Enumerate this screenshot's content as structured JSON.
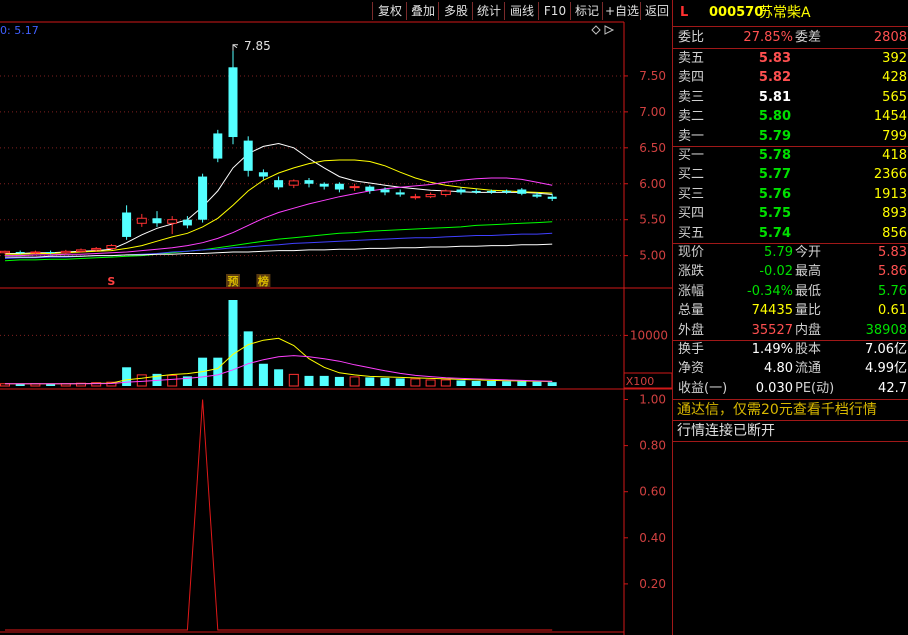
{
  "toolbar": {
    "buttons": [
      "复权",
      "叠加",
      "多股",
      "统计",
      "画线",
      "F10",
      "标记",
      "+自选",
      "返回"
    ]
  },
  "main_chart": {
    "ma_legend": "0: 5.17",
    "peak_label": "7.85",
    "y_ticks": [
      "7.50",
      "7.00",
      "6.50",
      "6.00",
      "5.50",
      "5.00"
    ],
    "markers": [
      "S",
      "预",
      "榜"
    ],
    "colors": {
      "up": "#ff3232",
      "down": "#54ffff",
      "ma5": "#ffffff",
      "ma10": "#ffff00",
      "ma20": "#ff40ff",
      "ma30": "#00ff00",
      "ma60": "#4040ff",
      "ma120": "#ffffff"
    }
  },
  "volume_chart": {
    "y_tick": "10000",
    "scale_label": "X100"
  },
  "indicator_chart": {
    "y_ticks": [
      "1.00",
      "0.80",
      "0.60",
      "0.40",
      "0.20"
    ]
  },
  "quote": {
    "indicator": "L",
    "code": "000570",
    "name": "苏常柴A",
    "weibi_label": "委比",
    "weibi": "27.85%",
    "weicha_label": "委差",
    "weicha": "2808",
    "asks": [
      {
        "label": "卖五",
        "price": "5.83",
        "vol": "392"
      },
      {
        "label": "卖四",
        "price": "5.82",
        "vol": "428"
      },
      {
        "label": "卖三",
        "price": "5.81",
        "vol": "565"
      },
      {
        "label": "卖二",
        "price": "5.80",
        "vol": "1454"
      },
      {
        "label": "卖一",
        "price": "5.79",
        "vol": "799"
      }
    ],
    "bids": [
      {
        "label": "买一",
        "price": "5.78",
        "vol": "418"
      },
      {
        "label": "买二",
        "price": "5.77",
        "vol": "2366"
      },
      {
        "label": "买三",
        "price": "5.76",
        "vol": "1913"
      },
      {
        "label": "买四",
        "price": "5.75",
        "vol": "893"
      },
      {
        "label": "买五",
        "price": "5.74",
        "vol": "856"
      }
    ],
    "stats": [
      {
        "l1": "现价",
        "v1": "5.79",
        "l2": "今开",
        "v2": "5.83"
      },
      {
        "l1": "涨跌",
        "v1": "-0.02",
        "l2": "最高",
        "v2": "5.86"
      },
      {
        "l1": "涨幅",
        "v1": "-0.34%",
        "l2": "最低",
        "v2": "5.76"
      },
      {
        "l1": "总量",
        "v1": "74435",
        "l2": "量比",
        "v2": "0.61"
      },
      {
        "l1": "外盘",
        "v1": "35527",
        "l2": "内盘",
        "v2": "38908"
      }
    ],
    "fin": [
      {
        "l1": "换手",
        "v1": "1.49%",
        "l2": "股本",
        "v2": "7.06亿"
      },
      {
        "l1": "净资",
        "v1": "4.80",
        "l2": "流通",
        "v2": "4.99亿"
      },
      {
        "l1": "收益(一)",
        "v1": "0.030",
        "l2": "PE(动)",
        "v2": "42.7"
      }
    ],
    "promo": "通达信，仅需20元查看千档行情",
    "status": "行情连接已断开"
  },
  "chart_data": [
    {
      "type": "candlestick",
      "title": "",
      "ylim": [
        4.8,
        8.0
      ],
      "yticks": [
        5.0,
        5.5,
        6.0,
        6.5,
        7.0,
        7.5
      ],
      "grid": true,
      "candles": [
        [
          5.04,
          5.06,
          5.02,
          5.07
        ],
        [
          5.05,
          5.04,
          5.02,
          5.07
        ],
        [
          5.04,
          5.05,
          5.02,
          5.07
        ],
        [
          5.05,
          5.04,
          5.02,
          5.07
        ],
        [
          5.04,
          5.06,
          5.02,
          5.08
        ],
        [
          5.06,
          5.08,
          5.04,
          5.1
        ],
        [
          5.08,
          5.1,
          5.06,
          5.12
        ],
        [
          5.1,
          5.14,
          5.08,
          5.16
        ],
        [
          5.6,
          5.26,
          5.22,
          5.7
        ],
        [
          5.45,
          5.52,
          5.4,
          5.58
        ],
        [
          5.52,
          5.45,
          5.4,
          5.62
        ],
        [
          5.45,
          5.5,
          5.3,
          5.55
        ],
        [
          5.5,
          5.42,
          5.38,
          5.55
        ],
        [
          6.1,
          5.5,
          5.46,
          6.14
        ],
        [
          6.7,
          6.35,
          6.3,
          6.75
        ],
        [
          7.62,
          6.65,
          6.55,
          7.85
        ],
        [
          6.6,
          6.18,
          6.1,
          6.66
        ],
        [
          6.16,
          6.1,
          6.06,
          6.2
        ],
        [
          6.05,
          5.95,
          5.92,
          6.1
        ],
        [
          5.98,
          6.04,
          5.94,
          6.06
        ],
        [
          6.05,
          6.0,
          5.95,
          6.08
        ],
        [
          6.0,
          5.96,
          5.92,
          6.02
        ],
        [
          6.0,
          5.92,
          5.88,
          6.02
        ],
        [
          5.95,
          5.96,
          5.9,
          6.0
        ],
        [
          5.96,
          5.9,
          5.86,
          5.98
        ],
        [
          5.92,
          5.88,
          5.84,
          5.95
        ],
        [
          5.88,
          5.85,
          5.82,
          5.92
        ],
        [
          5.82,
          5.82,
          5.78,
          5.86
        ],
        [
          5.82,
          5.85,
          5.8,
          5.88
        ],
        [
          5.85,
          5.9,
          5.82,
          5.92
        ],
        [
          5.92,
          5.88,
          5.85,
          5.95
        ],
        [
          5.9,
          5.88,
          5.86,
          5.93
        ],
        [
          5.9,
          5.88,
          5.86,
          5.92
        ],
        [
          5.9,
          5.88,
          5.86,
          5.92
        ],
        [
          5.92,
          5.86,
          5.84,
          5.94
        ],
        [
          5.85,
          5.82,
          5.8,
          5.88
        ],
        [
          5.82,
          5.79,
          5.76,
          5.86
        ]
      ],
      "ma_series": [
        {
          "values": [
            5.03,
            5.03,
            5.04,
            5.04,
            5.05,
            5.06,
            5.07,
            5.09,
            5.18,
            5.29,
            5.38,
            5.44,
            5.5,
            5.68,
            5.9,
            6.22,
            6.42,
            6.52,
            6.56,
            6.5,
            6.35,
            6.22,
            6.1,
            6.04,
            6.01,
            5.98,
            5.95,
            5.93,
            5.91,
            5.9,
            5.89,
            5.88,
            5.88,
            5.88,
            5.88,
            5.87,
            5.85
          ]
        },
        {
          "values": [
            5.02,
            5.02,
            5.03,
            5.03,
            5.04,
            5.05,
            5.06,
            5.07,
            5.1,
            5.14,
            5.2,
            5.26,
            5.31,
            5.4,
            5.52,
            5.7,
            5.9,
            6.05,
            6.15,
            6.22,
            6.28,
            6.32,
            6.33,
            6.33,
            6.31,
            6.25,
            6.16,
            6.08,
            6.02,
            5.98,
            5.95,
            5.93,
            5.91,
            5.9,
            5.89,
            5.88,
            5.87
          ]
        },
        {
          "values": [
            5.0,
            5.0,
            5.01,
            5.01,
            5.02,
            5.02,
            5.03,
            5.04,
            5.05,
            5.07,
            5.09,
            5.11,
            5.14,
            5.18,
            5.24,
            5.32,
            5.42,
            5.52,
            5.6,
            5.66,
            5.72,
            5.77,
            5.82,
            5.86,
            5.9,
            5.93,
            5.95,
            5.97,
            5.99,
            6.02,
            6.05,
            6.07,
            6.08,
            6.08,
            6.06,
            6.02,
            5.98
          ]
        },
        {
          "values": [
            4.93,
            4.94,
            4.94,
            4.95,
            4.95,
            4.96,
            4.97,
            4.98,
            4.99,
            5.0,
            5.02,
            5.04,
            5.06,
            5.08,
            5.11,
            5.14,
            5.17,
            5.2,
            5.23,
            5.25,
            5.27,
            5.29,
            5.31,
            5.32,
            5.34,
            5.35,
            5.36,
            5.37,
            5.38,
            5.39,
            5.4,
            5.42,
            5.43,
            5.44,
            5.45,
            5.46,
            5.47
          ]
        },
        {
          "values": [
            4.96,
            4.97,
            4.97,
            4.98,
            4.98,
            4.99,
            5.0,
            5.0,
            5.01,
            5.02,
            5.03,
            5.05,
            5.06,
            5.08,
            5.09,
            5.11,
            5.12,
            5.14,
            5.15,
            5.17,
            5.18,
            5.19,
            5.2,
            5.21,
            5.22,
            5.23,
            5.24,
            5.25,
            5.25,
            5.26,
            5.27,
            5.28,
            5.28,
            5.29,
            5.3,
            5.3,
            5.31
          ]
        },
        {
          "values": [
            4.98,
            4.98,
            4.98,
            4.99,
            4.99,
            4.99,
            5.0,
            5.0,
            5.01,
            5.01,
            5.02,
            5.02,
            5.03,
            5.03,
            5.04,
            5.05,
            5.05,
            5.06,
            5.07,
            5.07,
            5.08,
            5.08,
            5.09,
            5.09,
            5.1,
            5.1,
            5.11,
            5.11,
            5.12,
            5.12,
            5.13,
            5.13,
            5.14,
            5.14,
            5.15,
            5.15,
            5.16
          ]
        }
      ]
    },
    {
      "type": "bar",
      "title": "",
      "ylim": [
        0,
        17000
      ],
      "yticks": [
        10000
      ],
      "values": [
        450,
        450,
        450,
        450,
        450,
        550,
        650,
        750,
        3700,
        2200,
        2400,
        2100,
        1900,
        5600,
        5600,
        17000,
        10800,
        4400,
        3300,
        2300,
        2000,
        2000,
        1800,
        1800,
        1700,
        1600,
        1500,
        1400,
        1200,
        1200,
        1100,
        1000,
        1000,
        950,
        900,
        850,
        750
      ],
      "ma_series": [
        {
          "values": [
            450,
            450,
            450,
            450,
            450,
            470,
            510,
            570,
            1220,
            1550,
            1940,
            2280,
            2460,
            2840,
            3460,
            6260,
            8180,
            9060,
            9420,
            8000,
            5400,
            3700,
            2600,
            2200,
            1900,
            1800,
            1700,
            1600,
            1500,
            1400,
            1300,
            1200,
            1100,
            1050,
            980,
            940,
            890
          ]
        },
        {
          "values": [
            450,
            450,
            450,
            450,
            450,
            460,
            480,
            500,
            760,
            900,
            1100,
            1300,
            1500,
            1800,
            2200,
            3200,
            4400,
            5200,
            5800,
            6000,
            5800,
            5400,
            4900,
            4200,
            3600,
            3000,
            2500,
            2100,
            1850,
            1650,
            1500,
            1400,
            1300,
            1200,
            1100,
            1000,
            950
          ]
        }
      ]
    },
    {
      "type": "line",
      "title": "",
      "ylim": [
        0,
        1.05
      ],
      "yticks": [
        0.2,
        0.4,
        0.6,
        0.8,
        1.0
      ],
      "values": [
        0,
        0,
        0,
        0,
        0,
        0,
        0,
        0,
        0,
        0,
        0,
        0,
        0,
        1,
        0,
        0,
        0,
        0,
        0,
        0,
        0,
        0,
        0,
        0,
        0,
        0,
        0,
        0,
        0,
        0,
        0,
        0,
        0,
        0,
        0,
        0,
        0
      ]
    }
  ]
}
